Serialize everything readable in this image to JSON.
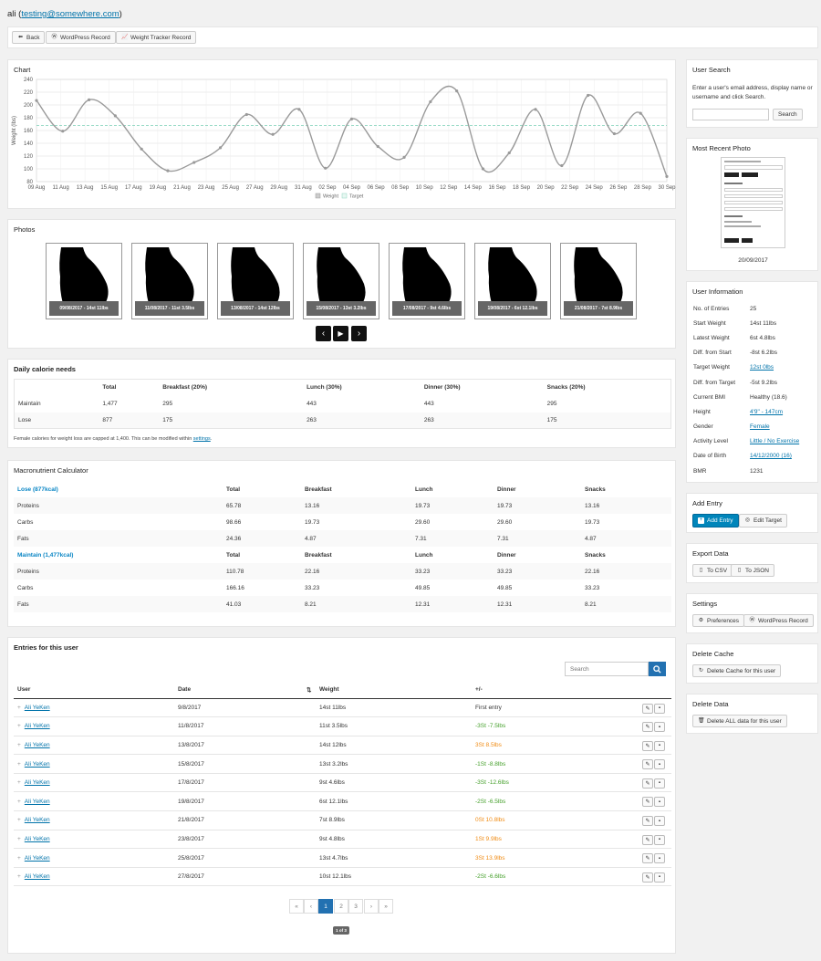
{
  "header": {
    "user": "ali",
    "email_paren_open": "(",
    "email": "testing@somewhere.com",
    "email_paren_close": ")"
  },
  "toolbar": {
    "back": "Back",
    "wp_record": "WordPress Record",
    "wt_record": "Weight Tracker Record"
  },
  "chart_panel": {
    "title": "Chart"
  },
  "chart_data": {
    "type": "line",
    "title": "",
    "ylabel": "Weight (lbs)",
    "xlabel": "",
    "ylim": [
      80,
      240
    ],
    "yticks": [
      "80",
      "100",
      "120",
      "140",
      "160",
      "180",
      "200",
      "220",
      "240"
    ],
    "xticks": [
      "09 Aug",
      "11 Aug",
      "13 Aug",
      "15 Aug",
      "17 Aug",
      "19 Aug",
      "21 Aug",
      "23 Aug",
      "25 Aug",
      "27 Aug",
      "29 Aug",
      "31 Aug",
      "02 Sep",
      "04 Sep",
      "06 Sep",
      "08 Sep",
      "10 Sep",
      "12 Sep",
      "14 Sep",
      "16 Sep",
      "18 Sep",
      "20 Sep",
      "22 Sep",
      "24 Sep",
      "26 Sep",
      "28 Sep",
      "30 Sep"
    ],
    "x": [
      "09 Aug",
      "11 Aug",
      "13 Aug",
      "15 Aug",
      "17 Aug",
      "19 Aug",
      "21 Aug",
      "23 Aug",
      "25 Aug",
      "27 Aug",
      "29 Aug",
      "31 Aug",
      "02 Sep",
      "04 Sep",
      "06 Sep",
      "08 Sep",
      "10 Sep",
      "12 Sep",
      "14 Sep",
      "16 Sep",
      "18 Sep",
      "20 Sep",
      "22 Sep",
      "24 Sep",
      "26 Sep",
      "28 Sep",
      "30 Sep"
    ],
    "series": [
      {
        "name": "Weight",
        "color": "#9a9a9a",
        "values": [
          207,
          159,
          208,
          183,
          131,
          97,
          110,
          133,
          185,
          154,
          193,
          101,
          178,
          135,
          118,
          205,
          222,
          100,
          125,
          193,
          105,
          215,
          155,
          187,
          88
        ]
      },
      {
        "name": "Target",
        "color": "#8fd6c0",
        "values": [
          168
        ]
      }
    ],
    "legend": "bottom",
    "grid": true
  },
  "photos": {
    "title": "Photos",
    "items": [
      {
        "label": "09/08/2017 - 14st 11lbs"
      },
      {
        "label": "11/08/2017 - 11st 3.5lbs"
      },
      {
        "label": "13/08/2017 - 14st 12lbs"
      },
      {
        "label": "15/08/2017 - 13st 3.2lbs"
      },
      {
        "label": "17/08/2017 - 9st 4.6lbs"
      },
      {
        "label": "19/08/2017 - 6st 12.1lbs"
      },
      {
        "label": "21/08/2017 - 7st 8.9lbs"
      }
    ]
  },
  "calories": {
    "title": "Daily calorie needs",
    "headers": [
      "",
      "Total",
      "Breakfast (20%)",
      "Lunch (30%)",
      "Dinner (30%)",
      "Snacks (20%)"
    ],
    "rows": [
      [
        "Maintain",
        "1,477",
        "295",
        "443",
        "443",
        "295"
      ],
      [
        "Lose",
        "877",
        "175",
        "263",
        "263",
        "175"
      ]
    ],
    "note_pre": "Female calories for weight loss are capped at 1,400. This can be modified within ",
    "note_link": "settings",
    "note_post": "."
  },
  "macro": {
    "title": "Macronutrient Calculator",
    "lose_header": [
      "Lose (877kcal)",
      "Total",
      "Breakfast",
      "Lunch",
      "Dinner",
      "Snacks"
    ],
    "lose_rows": [
      [
        "Proteins",
        "65.78",
        "13.16",
        "19.73",
        "19.73",
        "13.16"
      ],
      [
        "Carbs",
        "98.66",
        "19.73",
        "29.60",
        "29.60",
        "19.73"
      ],
      [
        "Fats",
        "24.36",
        "4.87",
        "7.31",
        "7.31",
        "4.87"
      ]
    ],
    "maintain_header": [
      "Maintain (1,477kcal)",
      "Total",
      "Breakfast",
      "Lunch",
      "Dinner",
      "Snacks"
    ],
    "maintain_rows": [
      [
        "Proteins",
        "110.78",
        "22.16",
        "33.23",
        "33.23",
        "22.16"
      ],
      [
        "Carbs",
        "166.16",
        "33.23",
        "49.85",
        "49.85",
        "33.23"
      ],
      [
        "Fats",
        "41.03",
        "8.21",
        "12.31",
        "12.31",
        "8.21"
      ]
    ]
  },
  "entries": {
    "title": "Entries for this user",
    "search_placeholder": "Search",
    "headers": [
      "User",
      "Date",
      "Weight",
      "+/-"
    ],
    "rows": [
      {
        "user": "Ali YeKen",
        "date": "9/8/2017",
        "weight": "14st 11lbs",
        "diff": "First entry",
        "cls": ""
      },
      {
        "user": "Ali YeKen",
        "date": "11/8/2017",
        "weight": "11st 3.5lbs",
        "diff": "-3St -7.5lbs",
        "cls": "green"
      },
      {
        "user": "Ali YeKen",
        "date": "13/8/2017",
        "weight": "14st 12lbs",
        "diff": "3St 8.5lbs",
        "cls": "orange"
      },
      {
        "user": "Ali YeKen",
        "date": "15/8/2017",
        "weight": "13st 3.2lbs",
        "diff": "-1St -8.8lbs",
        "cls": "green"
      },
      {
        "user": "Ali YeKen",
        "date": "17/8/2017",
        "weight": "9st 4.6lbs",
        "diff": "-3St -12.6lbs",
        "cls": "green"
      },
      {
        "user": "Ali YeKen",
        "date": "19/8/2017",
        "weight": "6st 12.1lbs",
        "diff": "-2St -6.5lbs",
        "cls": "green"
      },
      {
        "user": "Ali YeKen",
        "date": "21/8/2017",
        "weight": "7st 8.9lbs",
        "diff": "0St 10.8lbs",
        "cls": "orange"
      },
      {
        "user": "Ali YeKen",
        "date": "23/8/2017",
        "weight": "9st 4.8lbs",
        "diff": "1St 9.9lbs",
        "cls": "orange"
      },
      {
        "user": "Ali YeKen",
        "date": "25/8/2017",
        "weight": "13st 4.7lbs",
        "diff": "3St 13.9lbs",
        "cls": "orange"
      },
      {
        "user": "Ali YeKen",
        "date": "27/8/2017",
        "weight": "10st 12.1lbs",
        "diff": "-2St -6.6lbs",
        "cls": "green"
      }
    ],
    "pagination": [
      "«",
      "‹",
      "1",
      "2",
      "3",
      "›",
      "»"
    ],
    "page_info": "1 of 3"
  },
  "user_search": {
    "title": "User Search",
    "desc": "Enter a user's email address, display name or username and click Search.",
    "button": "Search"
  },
  "recent_photo": {
    "title": "Most Recent Photo",
    "date": "20/09/2017"
  },
  "user_info": {
    "title": "User Information",
    "rows": [
      {
        "k": "No. of Entries",
        "v": "25",
        "link": false
      },
      {
        "k": "Start Weight",
        "v": "14st 11lbs",
        "link": false
      },
      {
        "k": "Latest Weight",
        "v": "6st 4.8lbs",
        "link": false
      },
      {
        "k": "Diff. from Start",
        "v": "-8st 6.2lbs",
        "link": false
      },
      {
        "k": "Target Weight",
        "v": "12st 0lbs",
        "link": true
      },
      {
        "k": "Diff. from Target",
        "v": "-5st 9.2lbs",
        "link": false
      },
      {
        "k": "Current BMI",
        "v": "Healthy (18.6)",
        "link": false
      },
      {
        "k": "Height",
        "v": "4'9\" - 147cm",
        "link": true
      },
      {
        "k": "Gender",
        "v": "Female",
        "link": true
      },
      {
        "k": "Activity Level",
        "v": "Little / No Exercise",
        "link": true
      },
      {
        "k": "Date of Birth",
        "v": "14/12/2000 (16)",
        "link": true
      },
      {
        "k": "BMR",
        "v": "1231",
        "link": false
      }
    ]
  },
  "add_entry": {
    "title": "Add Entry",
    "add": "Add Entry",
    "edit_target": "Edit Target"
  },
  "export": {
    "title": "Export Data",
    "csv": "To CSV",
    "json": "To JSON"
  },
  "settings": {
    "title": "Settings",
    "prefs": "Preferences",
    "wp": "WordPress Record"
  },
  "delete_cache": {
    "title": "Delete Cache",
    "button": "Delete Cache for this user"
  },
  "delete_data": {
    "title": "Delete Data",
    "button": "Delete ALL data for this user"
  }
}
